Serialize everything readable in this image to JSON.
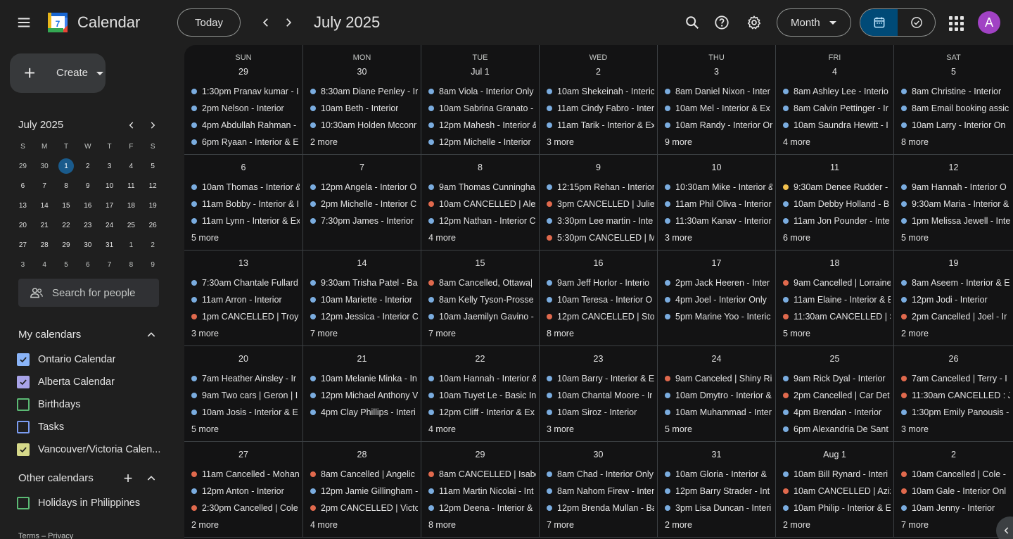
{
  "header": {
    "app_title": "Calendar",
    "logo_text": "7",
    "today_label": "Today",
    "month_title": "July 2025",
    "view_label": "Month",
    "avatar_letter": "A"
  },
  "sidebar": {
    "create_label": "Create",
    "mini_title": "July 2025",
    "mini_dows": [
      "S",
      "M",
      "T",
      "W",
      "T",
      "F",
      "S"
    ],
    "mini_days": [
      [
        {
          "d": "29",
          "o": true
        },
        {
          "d": "30",
          "o": true
        },
        {
          "d": "1",
          "t": true
        },
        {
          "d": "2"
        },
        {
          "d": "3"
        },
        {
          "d": "4"
        },
        {
          "d": "5"
        }
      ],
      [
        {
          "d": "6"
        },
        {
          "d": "7"
        },
        {
          "d": "8"
        },
        {
          "d": "9"
        },
        {
          "d": "10"
        },
        {
          "d": "11"
        },
        {
          "d": "12"
        }
      ],
      [
        {
          "d": "13"
        },
        {
          "d": "14"
        },
        {
          "d": "15"
        },
        {
          "d": "16"
        },
        {
          "d": "17"
        },
        {
          "d": "18"
        },
        {
          "d": "19"
        }
      ],
      [
        {
          "d": "20"
        },
        {
          "d": "21"
        },
        {
          "d": "22"
        },
        {
          "d": "23"
        },
        {
          "d": "24"
        },
        {
          "d": "25"
        },
        {
          "d": "26"
        }
      ],
      [
        {
          "d": "27"
        },
        {
          "d": "28"
        },
        {
          "d": "29"
        },
        {
          "d": "30"
        },
        {
          "d": "31"
        },
        {
          "d": "1",
          "o": true
        },
        {
          "d": "2",
          "o": true
        }
      ],
      [
        {
          "d": "3",
          "o": true
        },
        {
          "d": "4",
          "o": true
        },
        {
          "d": "5",
          "o": true
        },
        {
          "d": "6",
          "o": true
        },
        {
          "d": "7",
          "o": true
        },
        {
          "d": "8",
          "o": true
        },
        {
          "d": "9",
          "o": true
        }
      ]
    ],
    "search_people_placeholder": "Search for people",
    "my_calendars_title": "My calendars",
    "my_calendars": [
      {
        "name": "Ontario Calendar",
        "color": "#8ab4f8",
        "checked": true
      },
      {
        "name": "Alberta Calendar",
        "color": "#a8a3e8",
        "checked": true
      },
      {
        "name": "Birthdays",
        "color": "#5bb974",
        "checked": false
      },
      {
        "name": "Tasks",
        "color": "#7b9cf0",
        "checked": false
      },
      {
        "name": "Vancouver/Victoria Calen...",
        "color": "#d6d98a",
        "checked": true
      }
    ],
    "other_calendars_title": "Other calendars",
    "other_calendars": [
      {
        "name": "Holidays in Philippines",
        "color": "#5bb974",
        "checked": false
      }
    ],
    "footer": "Terms – Privacy"
  },
  "colors": {
    "blue": "#7aacdf",
    "red": "#e0694d",
    "yellow": "#f2c14e"
  },
  "month": {
    "weeks": [
      [
        {
          "dow": "SUN",
          "date": "29",
          "events": [
            [
              "b",
              "1:30pm Pranav kumar - I"
            ],
            [
              "b",
              "2pm Nelson - Interior"
            ],
            [
              "b",
              "4pm Abdullah Rahman -"
            ],
            [
              "b",
              "6pm Ryaan - Interior & E"
            ]
          ],
          "more": ""
        },
        {
          "dow": "MON",
          "date": "30",
          "events": [
            [
              "b",
              "8:30am Diane Penley - Ir"
            ],
            [
              "b",
              "10am Beth - Interior"
            ],
            [
              "b",
              "10:30am Holden Mcconr"
            ]
          ],
          "more": "2 more"
        },
        {
          "dow": "TUE",
          "date": "Jul 1",
          "events": [
            [
              "b",
              "8am Viola - Interior Only"
            ],
            [
              "b",
              "10am Sabrina Granato -"
            ],
            [
              "b",
              "12pm Mahesh - Interior &"
            ],
            [
              "b",
              "12pm Michelle - Interior"
            ]
          ],
          "more": ""
        },
        {
          "dow": "WED",
          "date": "2",
          "events": [
            [
              "b",
              "10am Shekeinah - Interic"
            ],
            [
              "b",
              "11am Cindy Fabro - Inter"
            ],
            [
              "b",
              "11am Tarik - Interior & Ex"
            ]
          ],
          "more": "3 more"
        },
        {
          "dow": "THU",
          "date": "3",
          "events": [
            [
              "b",
              "8am Daniel Nixon - Inter"
            ],
            [
              "b",
              "10am Mel - Interior & Ex"
            ],
            [
              "b",
              "10am Randy - Interior Or"
            ]
          ],
          "more": "9 more"
        },
        {
          "dow": "FRI",
          "date": "4",
          "events": [
            [
              "b",
              "8am Ashley Lee - Interio"
            ],
            [
              "b",
              "8am Calvin Pettinger - Ir"
            ],
            [
              "b",
              "10am Saundra Hewitt - I"
            ]
          ],
          "more": "4 more"
        },
        {
          "dow": "SAT",
          "date": "5",
          "events": [
            [
              "b",
              "8am Christine - Interior"
            ],
            [
              "b",
              "8am Email booking assic"
            ],
            [
              "b",
              "10am Larry - Interior On"
            ]
          ],
          "more": "8 more"
        }
      ],
      [
        {
          "date": "6",
          "events": [
            [
              "b",
              "10am Thomas - Interior &"
            ],
            [
              "b",
              "11am Bobby - Interior & I"
            ],
            [
              "b",
              "11am Lynn - Interior & Ex"
            ]
          ],
          "more": "5 more"
        },
        {
          "date": "7",
          "events": [
            [
              "b",
              "12pm Angela - Interior O"
            ],
            [
              "b",
              "2pm Michelle - Interior C"
            ],
            [
              "b",
              "7:30pm James - Interior"
            ]
          ],
          "more": ""
        },
        {
          "date": "8",
          "events": [
            [
              "b",
              "9am Thomas Cunningha"
            ],
            [
              "r",
              "10am CANCELLED | Alex"
            ],
            [
              "b",
              "12pm Nathan - Interior C"
            ]
          ],
          "more": "4 more"
        },
        {
          "date": "9",
          "events": [
            [
              "b",
              "12:15pm Rehan - Interior"
            ],
            [
              "r",
              "3pm CANCELLED | Julie"
            ],
            [
              "b",
              "3:30pm Lee martin - Inte"
            ],
            [
              "r",
              "5:30pm CANCELLED | M"
            ]
          ],
          "more": ""
        },
        {
          "date": "10",
          "events": [
            [
              "b",
              "10:30am Mike - Interior &"
            ],
            [
              "b",
              "11am Phil Oliva - Interior"
            ],
            [
              "b",
              "11:30am Kanav - Interior"
            ]
          ],
          "more": "3 more"
        },
        {
          "date": "11",
          "events": [
            [
              "y",
              "9:30am Denee Rudder -"
            ],
            [
              "b",
              "10am Debby Holland - B"
            ],
            [
              "b",
              "11am Jon Pounder - Inte"
            ]
          ],
          "more": "6 more"
        },
        {
          "date": "12",
          "events": [
            [
              "b",
              "9am Hannah - Interior O"
            ],
            [
              "b",
              "9:30am Maria - Interior &"
            ],
            [
              "b",
              "1pm Melissa Jewell - Inte"
            ]
          ],
          "more": "5 more"
        }
      ],
      [
        {
          "date": "13",
          "events": [
            [
              "b",
              "7:30am Chantale Fullard"
            ],
            [
              "b",
              "11am Arron - Interior"
            ],
            [
              "r",
              "1pm CANCELLED | Troy C"
            ]
          ],
          "more": "3 more"
        },
        {
          "date": "14",
          "events": [
            [
              "b",
              "9:30am Trisha Patel - Ba"
            ],
            [
              "b",
              "10am Mariette - Interior"
            ],
            [
              "b",
              "12pm Jessica - Interior C"
            ]
          ],
          "more": "7 more"
        },
        {
          "date": "15",
          "events": [
            [
              "r",
              "8am Cancelled, Ottawa|"
            ],
            [
              "b",
              "8am Kelly Tyson-Prosse"
            ],
            [
              "b",
              "10am Jaemilyn Gavino -"
            ]
          ],
          "more": "7 more"
        },
        {
          "date": "16",
          "events": [
            [
              "b",
              "9am Jeff Horlor - Interio"
            ],
            [
              "b",
              "10am Teresa - Interior O"
            ],
            [
              "r",
              "12pm CANCELLED | Stor"
            ]
          ],
          "more": "8 more"
        },
        {
          "date": "17",
          "events": [
            [
              "b",
              "2pm Jack Heeren - Inter"
            ],
            [
              "b",
              "4pm Joel - Interior Only"
            ],
            [
              "b",
              "5pm Marine Yoo - Interic"
            ]
          ],
          "more": ""
        },
        {
          "date": "18",
          "events": [
            [
              "r",
              "9am Cancelled | Lorraine"
            ],
            [
              "b",
              "11am Elaine - Interior & E"
            ],
            [
              "r",
              "11:30am CANCELLED | S"
            ]
          ],
          "more": "5 more"
        },
        {
          "date": "19",
          "events": [
            [
              "b",
              "8am Aseem - Interior & E"
            ],
            [
              "b",
              "12pm Jodi - Interior"
            ],
            [
              "r",
              "2pm Cancelled | Joel - Ir"
            ]
          ],
          "more": "2 more"
        }
      ],
      [
        {
          "date": "20",
          "events": [
            [
              "b",
              "7am Heather Ainsley - Ir"
            ],
            [
              "b",
              "9am Two cars | Geron | I"
            ],
            [
              "b",
              "10am Josis - Interior & E"
            ]
          ],
          "more": "5 more"
        },
        {
          "date": "21",
          "events": [
            [
              "b",
              "10am Melanie Minka - In"
            ],
            [
              "b",
              "12pm Michael Anthony V"
            ],
            [
              "b",
              "4pm Clay Phillips - Interi"
            ]
          ],
          "more": ""
        },
        {
          "date": "22",
          "events": [
            [
              "b",
              "10am Hannah - Interior &"
            ],
            [
              "b",
              "10am Tuyet Le - Basic In"
            ],
            [
              "b",
              "12pm Cliff - Interior & Ex"
            ]
          ],
          "more": "4 more"
        },
        {
          "date": "23",
          "events": [
            [
              "b",
              "10am Barry - Interior & E"
            ],
            [
              "b",
              "10am Chantal Moore - Ir"
            ],
            [
              "b",
              "10am Siroz - Interior"
            ]
          ],
          "more": "3 more"
        },
        {
          "date": "24",
          "events": [
            [
              "r",
              "9am Canceled | Shiny Ri"
            ],
            [
              "b",
              "10am Dmytro - Interior &"
            ],
            [
              "b",
              "10am Muhammad - Inter"
            ]
          ],
          "more": "5 more"
        },
        {
          "date": "25",
          "events": [
            [
              "b",
              "9am Rick Dyal - Interior"
            ],
            [
              "r",
              "2pm Cancelled | Car Det"
            ],
            [
              "b",
              "4pm Brendan - Interior"
            ],
            [
              "b",
              "6pm Alexandria De Sant"
            ]
          ],
          "more": ""
        },
        {
          "date": "26",
          "events": [
            [
              "r",
              "7am Cancelled | Terry - I"
            ],
            [
              "r",
              "11:30am CANCELLED : J"
            ],
            [
              "b",
              "1:30pm Emily Panousis -"
            ]
          ],
          "more": "3 more"
        }
      ],
      [
        {
          "date": "27",
          "events": [
            [
              "r",
              "11am Cancelled - Mohan"
            ],
            [
              "b",
              "12pm Anton - Interior"
            ],
            [
              "r",
              "2:30pm Cancelled | Cole"
            ]
          ],
          "more": "2 more"
        },
        {
          "date": "28",
          "events": [
            [
              "r",
              "8am Cancelled | Angelic"
            ],
            [
              "b",
              "12pm Jamie Gillingham -"
            ],
            [
              "r",
              "2pm CANCELLED | Victo"
            ]
          ],
          "more": "4 more"
        },
        {
          "date": "29",
          "events": [
            [
              "r",
              "8am CANCELLED | Isabe"
            ],
            [
              "b",
              "11am Martin Nicolai - Int"
            ],
            [
              "b",
              "12pm Deena - Interior &"
            ]
          ],
          "more": "8 more"
        },
        {
          "date": "30",
          "events": [
            [
              "b",
              "8am Chad - Interior Only"
            ],
            [
              "b",
              "8am Nahom Firew - Inter"
            ],
            [
              "b",
              "12pm Brenda Mullan - Ba"
            ]
          ],
          "more": "7 more"
        },
        {
          "date": "31",
          "events": [
            [
              "b",
              "10am Gloria - Interior &"
            ],
            [
              "b",
              "12pm Barry Strader - Int"
            ],
            [
              "b",
              "3pm Lisa Duncan - Interi"
            ]
          ],
          "more": "2 more"
        },
        {
          "date": "Aug 1",
          "events": [
            [
              "b",
              "10am Bill Rynard - Interi"
            ],
            [
              "r",
              "10am CANCELLED | Aziz"
            ],
            [
              "b",
              "10am Philip - Interior & E"
            ]
          ],
          "more": "2 more"
        },
        {
          "date": "2",
          "events": [
            [
              "r",
              "10am Cancelled | Cole -"
            ],
            [
              "r",
              "10am Gale - Interior Onl"
            ],
            [
              "b",
              "10am Jenny - Interior"
            ]
          ],
          "more": "7 more"
        }
      ]
    ]
  }
}
